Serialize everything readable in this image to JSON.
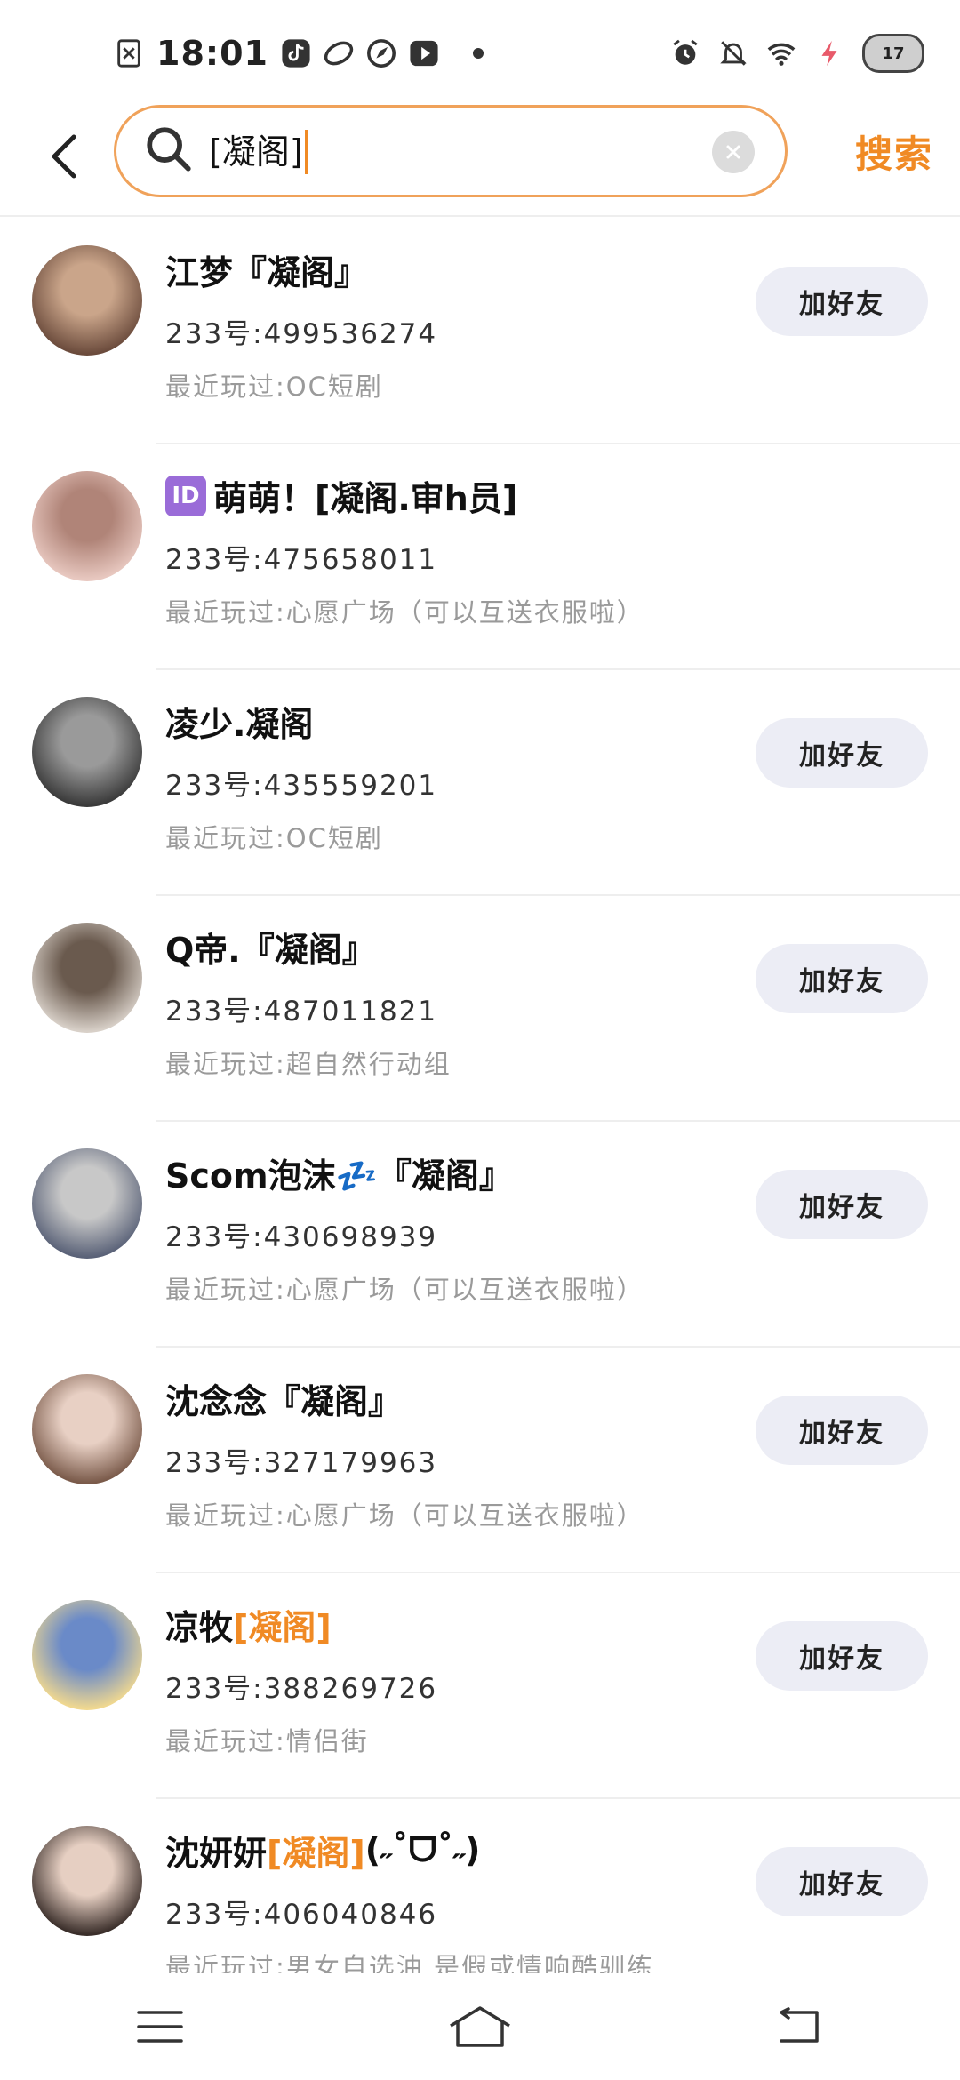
{
  "status_bar": {
    "time": "18:01",
    "left_icons": [
      "close-box-icon",
      "tiktok-icon",
      "bili-icon",
      "compass-icon",
      "play-icon"
    ],
    "right_icons": [
      "alarm-icon",
      "mute-bell-icon",
      "wifi-icon",
      "charging-icon"
    ],
    "battery": "17"
  },
  "search": {
    "query": "[凝阁]",
    "action_label": "搜索"
  },
  "results": [
    {
      "name_prefix": "江梦『凝阁』",
      "name_highlight": "",
      "name_suffix": "",
      "badge": "",
      "uid": "233号:499536274",
      "recent": "最近玩过:OC短剧",
      "button": "加好友",
      "avatar_color": "#6b4b3c",
      "avatar_color2": "#caa58a",
      "show_button": true
    },
    {
      "name_prefix": "萌萌！[凝阁.审h员]",
      "name_highlight": "",
      "name_suffix": "",
      "badge": "ID",
      "uid": "233号:475658011",
      "recent": "最近玩过:心愿广场（可以互送衣服啦）",
      "button": "",
      "avatar_color": "#e8c8c0",
      "avatar_color2": "#b08478",
      "show_button": false
    },
    {
      "name_prefix": "凌少.凝阁",
      "name_highlight": "",
      "name_suffix": "",
      "badge": "",
      "uid": "233号:435559201",
      "recent": "最近玩过:OC短剧",
      "button": "加好友",
      "avatar_color": "#3a3a3a",
      "avatar_color2": "#9a9a9a",
      "show_button": true
    },
    {
      "name_prefix": "Q帝.『凝阁』",
      "name_highlight": "",
      "name_suffix": "",
      "badge": "",
      "uid": "233号:487011821",
      "recent": "最近玩过:超自然行动组",
      "button": "加好友",
      "avatar_color": "#d8d0c8",
      "avatar_color2": "#6a5a4e",
      "show_button": true
    },
    {
      "name_prefix": "Scom泡沫💤『凝阁』",
      "name_highlight": "",
      "name_suffix": "",
      "badge": "",
      "uid": "233号:430698939",
      "recent": "最近玩过:心愿广场（可以互送衣服啦）",
      "button": "加好友",
      "avatar_color": "#5a6278",
      "avatar_color2": "#c8c8c8",
      "show_button": true
    },
    {
      "name_prefix": "沈念念『凝阁』",
      "name_highlight": "",
      "name_suffix": "",
      "badge": "",
      "uid": "233号:327179963",
      "recent": "最近玩过:心愿广场（可以互送衣服啦）",
      "button": "加好友",
      "avatar_color": "#7a5a4a",
      "avatar_color2": "#e8d0c4",
      "show_button": true
    },
    {
      "name_prefix": "凉牧",
      "name_highlight": "[凝阁]",
      "name_suffix": "",
      "badge": "",
      "uid": "233号:388269726",
      "recent": "最近玩过:情侣街",
      "button": "加好友",
      "avatar_color": "#f0d890",
      "avatar_color2": "#6a8ac8",
      "show_button": true
    },
    {
      "name_prefix": "沈妍妍",
      "name_highlight": "[凝阁]",
      "name_suffix": "(˶˚ᗜ˚˶)",
      "badge": "",
      "uid": "233号:406040846",
      "recent": "最近玩过:男女自选油 是假或情响酷驯练",
      "button": "加好友",
      "avatar_color": "#3a2e2a",
      "avatar_color2": "#e6cfc2",
      "show_button": true
    }
  ],
  "nav": {
    "icons": [
      "menu-icon",
      "home-icon",
      "back-icon"
    ]
  },
  "colors": {
    "accent": "#f08a24",
    "search_border": "#f0a25a",
    "button_bg": "#ecedf5"
  }
}
